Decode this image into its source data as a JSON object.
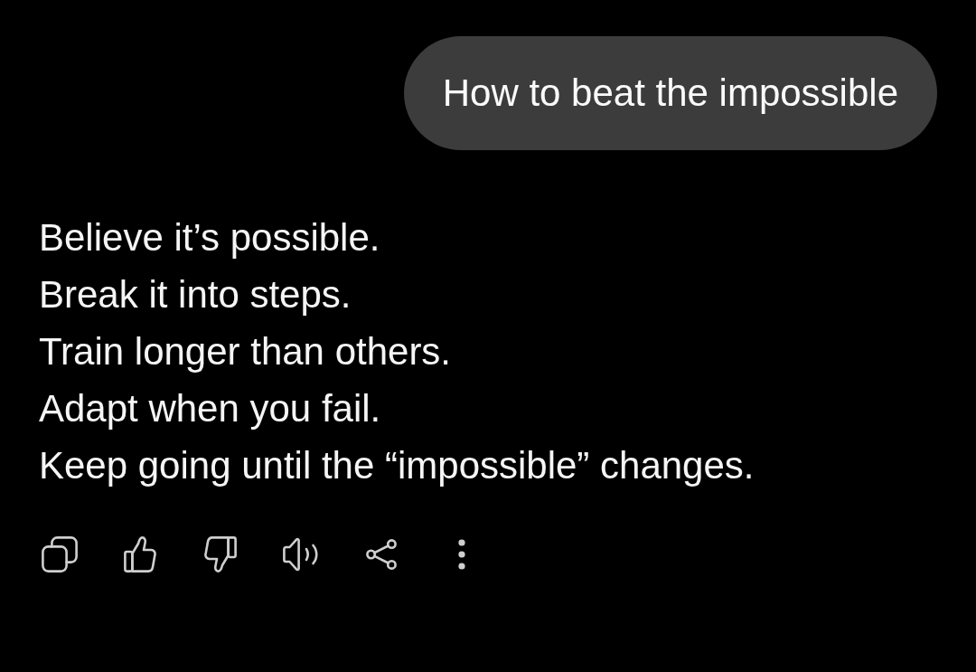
{
  "user_message": {
    "text": "How to beat the impossible"
  },
  "response": {
    "lines": [
      "Believe it’s possible.",
      "Break it into steps.",
      "Train longer than others.",
      "Adapt when you fail.",
      "Keep going until the “impossible” changes."
    ]
  },
  "actions": [
    {
      "kind": "copy"
    },
    {
      "kind": "like"
    },
    {
      "kind": "dislike"
    },
    {
      "kind": "read-aloud"
    },
    {
      "kind": "share"
    },
    {
      "kind": "more"
    }
  ]
}
